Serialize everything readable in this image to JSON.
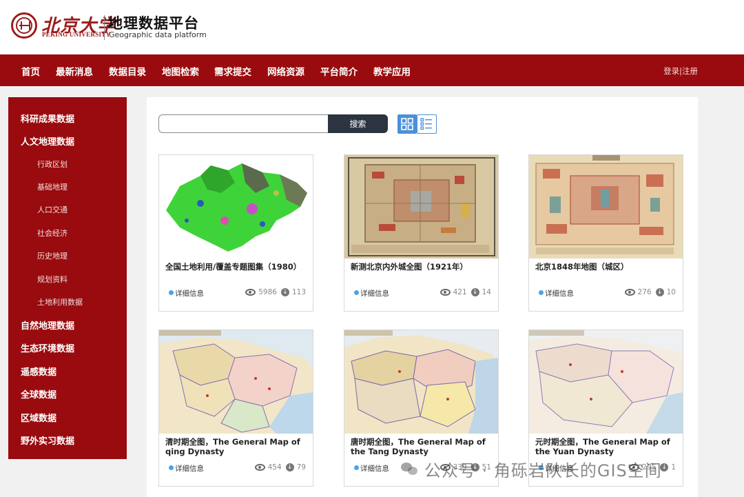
{
  "brand": {
    "cn_name": "北京大学",
    "en_name": "PEKING UNIVERSITY",
    "platform_title": "地理数据平台",
    "platform_subtitle": "Geographic data platform"
  },
  "nav": {
    "items": [
      "首页",
      "最新消息",
      "数据目录",
      "地图检索",
      "需求提交",
      "网络资源",
      "平台简介",
      "教学应用"
    ],
    "login": "登录",
    "separator": "|",
    "register": "注册"
  },
  "sidebar": {
    "sections": [
      {
        "label": "科研成果数据"
      },
      {
        "label": "人文地理数据",
        "children": [
          "行政区划",
          "基础地理",
          "人口交通",
          "社会经济",
          "历史地理",
          "规划资料",
          "土地利用数据"
        ]
      },
      {
        "label": "自然地理数据"
      },
      {
        "label": "生态环境数据"
      },
      {
        "label": "遥感数据"
      },
      {
        "label": "全球数据"
      },
      {
        "label": "区域数据"
      },
      {
        "label": "野外实习数据"
      }
    ]
  },
  "search": {
    "value": "",
    "button_label": "搜索"
  },
  "view_toggle": {
    "grid_icon": "grid-view-icon",
    "list_icon": "list-view-icon",
    "active": "grid"
  },
  "cards": [
    {
      "title": "全国土地利用/覆盖专题图集（1980）",
      "detail_label": "详细信息",
      "views": "5986",
      "downloads": "113",
      "thumb": "land-use-map"
    },
    {
      "title": "新测北京内外城全图（1921年）",
      "detail_label": "详细信息",
      "views": "421",
      "downloads": "14",
      "thumb": "beijing-1921-map"
    },
    {
      "title": "北京1848年地图（城区）",
      "detail_label": "详细信息",
      "views": "276",
      "downloads": "10",
      "thumb": "beijing-1848-map"
    },
    {
      "title": "清时期全图，The General Map of qing Dynasty",
      "detail_label": "详细信息",
      "views": "454",
      "downloads": "79",
      "thumb": "qing-dynasty-map"
    },
    {
      "title": "唐时期全图，The General Map of the Tang Dynasty",
      "detail_label": "详细信息",
      "views": "339",
      "downloads": "51",
      "thumb": "tang-dynasty-map"
    },
    {
      "title": "元时期全图，The General Map of the Yuan Dynasty",
      "detail_label": "详细信息",
      "views": "295",
      "downloads": "1",
      "thumb": "yuan-dynasty-map"
    }
  ],
  "watermark": {
    "text": "公众号 · 角砾岩队长的GIS空间"
  },
  "colors": {
    "brand_red": "#990b0e",
    "search_button": "#2b3440",
    "accent_blue": "#4a90d9"
  }
}
